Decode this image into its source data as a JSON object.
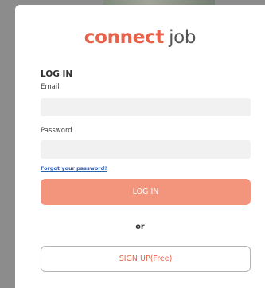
{
  "logo": {
    "brand": "connect",
    "suffix": "job"
  },
  "login_form": {
    "heading": "LOG IN",
    "email_label": "Email",
    "email_value": "",
    "password_label": "Password",
    "password_value": "",
    "forgot_link": "Forgot your password?",
    "login_button": "LOG IN",
    "or_text": "or",
    "signup_button": "SIGN UP(Free)"
  },
  "colors": {
    "brand": "#e8624a",
    "login_button": "#f3957d",
    "link": "#2b5fb0",
    "input_bg": "#f1f1f1"
  }
}
